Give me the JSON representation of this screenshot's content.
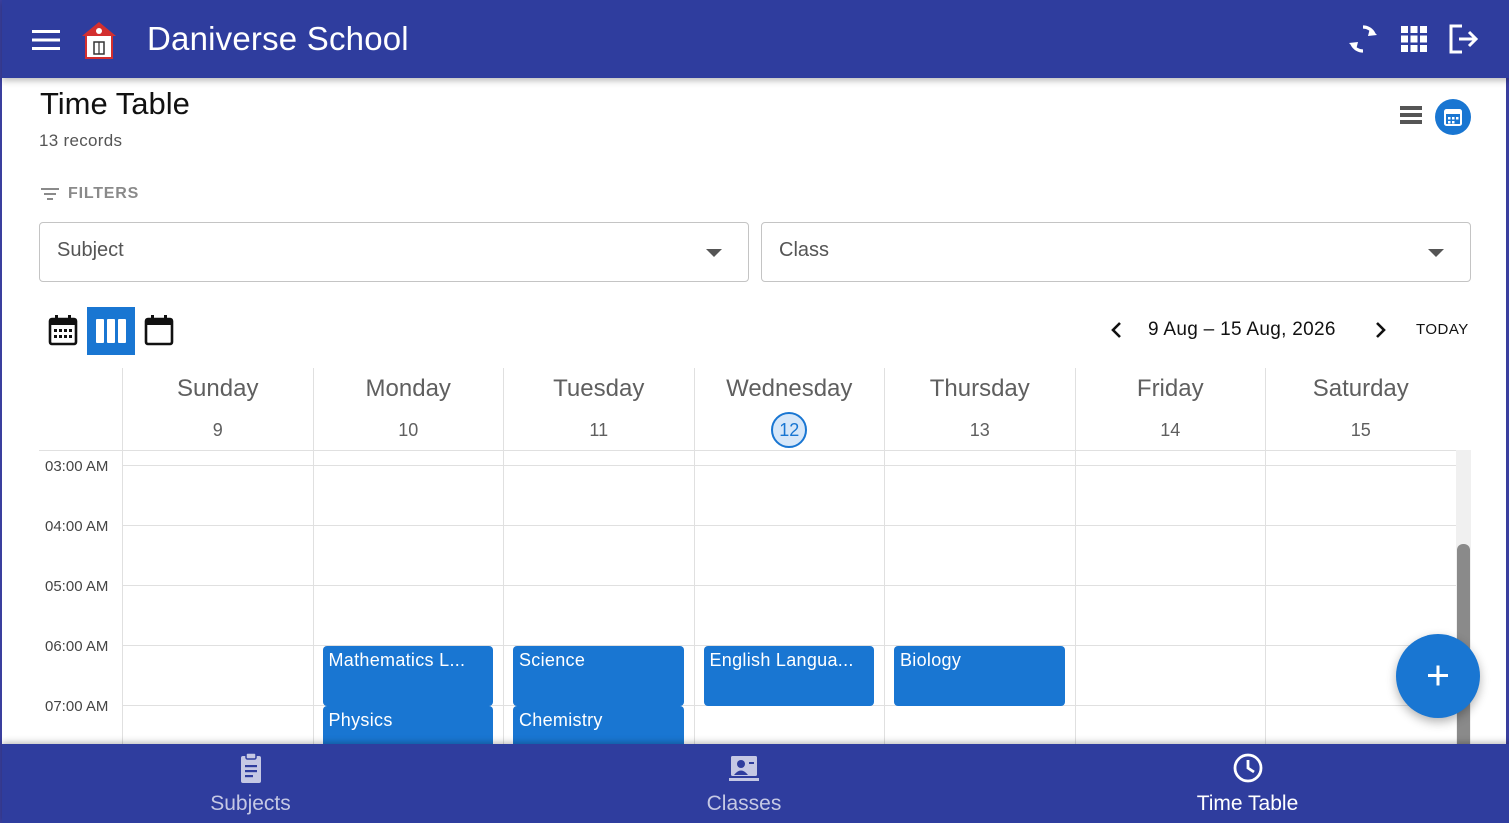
{
  "app": {
    "title": "Daniverse School"
  },
  "page": {
    "title": "Time Table",
    "record_count": "13 records"
  },
  "filters": {
    "label": "FILTERS",
    "subject_placeholder": "Subject",
    "class_placeholder": "Class"
  },
  "calendar": {
    "date_range": "9 Aug – 15 Aug, 2026",
    "today_label": "TODAY",
    "days": [
      {
        "name": "Sunday",
        "date": "9",
        "today": false
      },
      {
        "name": "Monday",
        "date": "10",
        "today": false
      },
      {
        "name": "Tuesday",
        "date": "11",
        "today": false
      },
      {
        "name": "Wednesday",
        "date": "12",
        "today": true
      },
      {
        "name": "Thursday",
        "date": "13",
        "today": false
      },
      {
        "name": "Friday",
        "date": "14",
        "today": false
      },
      {
        "name": "Saturday",
        "date": "15",
        "today": false
      }
    ],
    "times": [
      "03:00 AM",
      "04:00 AM",
      "05:00 AM",
      "06:00 AM",
      "07:00 AM"
    ],
    "events": [
      {
        "title": "Mathematics L...",
        "day": "Monday",
        "start": "06:00 AM"
      },
      {
        "title": "Physics",
        "day": "Monday",
        "start": "07:00 AM"
      },
      {
        "title": "Science",
        "day": "Tuesday",
        "start": "06:00 AM"
      },
      {
        "title": "Chemistry",
        "day": "Tuesday",
        "start": "07:00 AM"
      },
      {
        "title": "English Langua...",
        "day": "Wednesday",
        "start": "06:00 AM"
      },
      {
        "title": "Biology",
        "day": "Thursday",
        "start": "06:00 AM"
      }
    ],
    "accent_color": "#1976d2"
  },
  "bottom_nav": {
    "items": [
      {
        "label": "Subjects",
        "icon": "clipboard-icon",
        "active": false
      },
      {
        "label": "Classes",
        "icon": "classroom-icon",
        "active": false
      },
      {
        "label": "Time Table",
        "icon": "clock-icon",
        "active": true
      }
    ]
  },
  "colors": {
    "primary": "#2f3d9e",
    "accent": "#1976d2"
  }
}
